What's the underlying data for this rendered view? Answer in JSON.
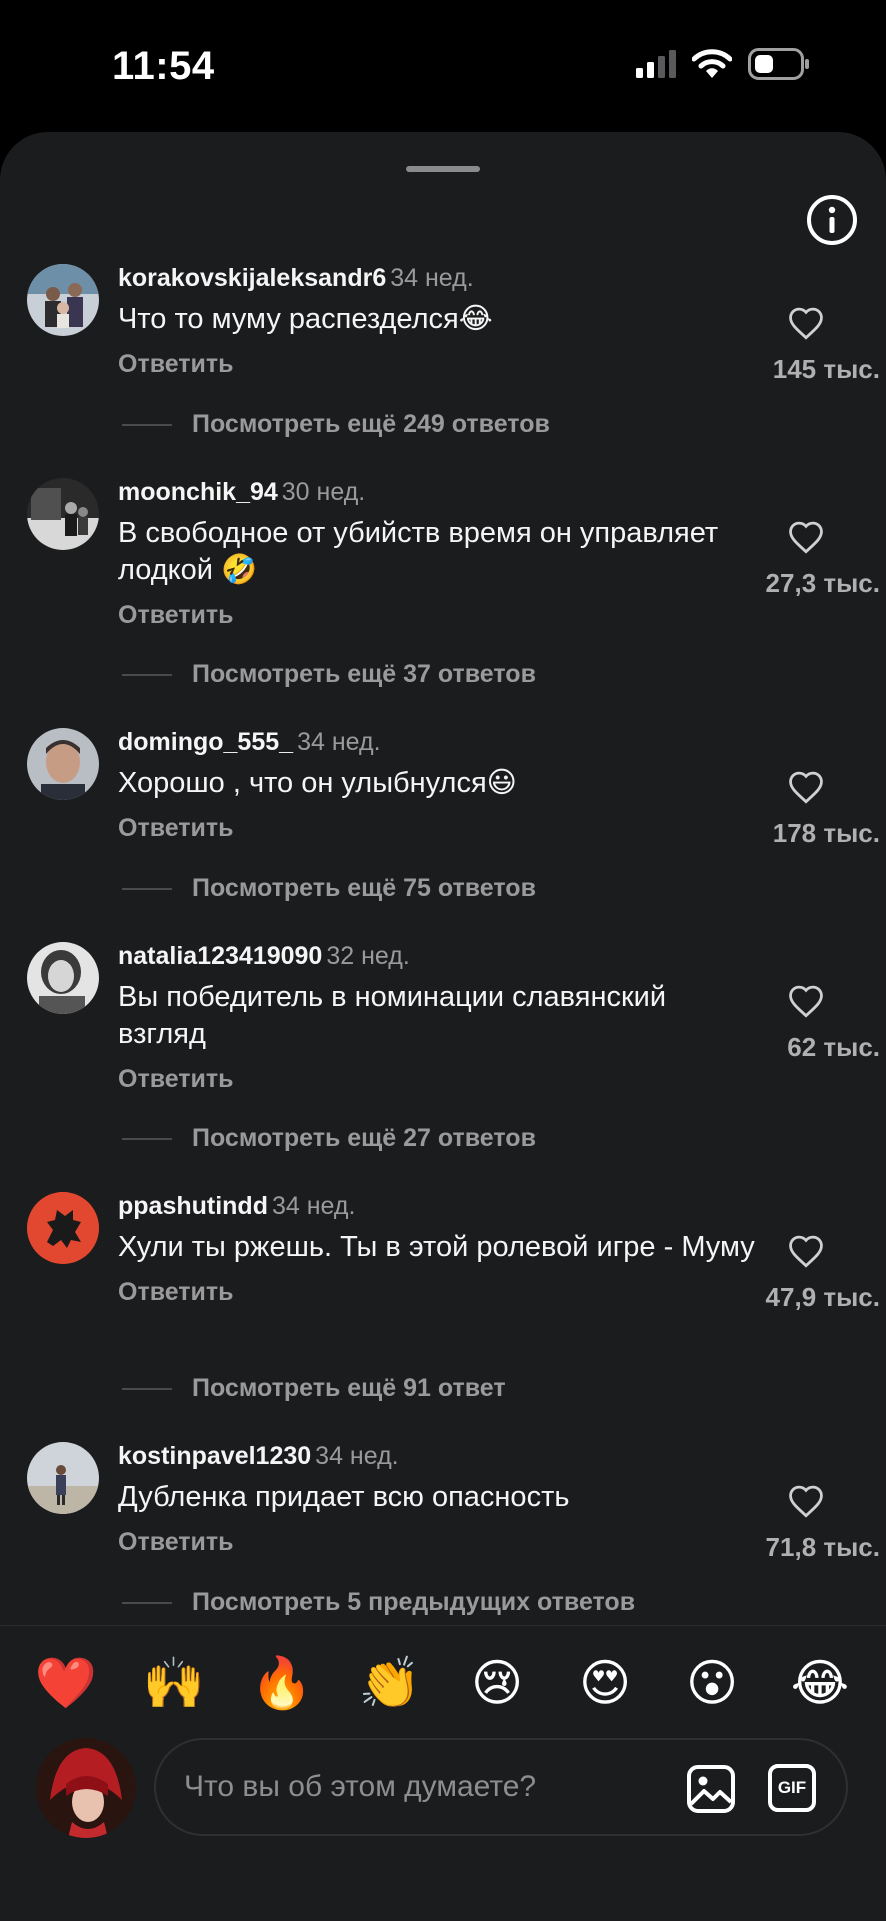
{
  "status": {
    "time": "11:54"
  },
  "comments": [
    {
      "username": "korakovskijaleksandr6",
      "time": "34 нед.",
      "text": "Что то муму распезделся😂",
      "reply": "Ответить",
      "likes": "145 тыс.",
      "more": "Посмотреть ещё 249 ответов"
    },
    {
      "username": "moonchik_94",
      "time": "30 нед.",
      "text": "В свободное от убийств время он управляет лодкой 🤣",
      "reply": "Ответить",
      "likes": "27,3 тыс.",
      "more": "Посмотреть ещё 37 ответов"
    },
    {
      "username": "domingo_555_",
      "time": "34 нед.",
      "text": "Хорошо , что он улыбнулся😃",
      "reply": "Ответить",
      "likes": "178 тыс.",
      "more": "Посмотреть ещё 75 ответов"
    },
    {
      "username": "natalia123419090",
      "time": "32 нед.",
      "text": "Вы победитель в номинации славянский взгляд",
      "reply": "Ответить",
      "likes": "62 тыс.",
      "more": "Посмотреть ещё 27 ответов"
    },
    {
      "username": "ppashutindd",
      "time": "34 нед.",
      "text": "Хули ты ржешь. Ты в этой ролевой игре - Муму",
      "reply": "Ответить",
      "likes": "47,9 тыс.",
      "more": "Посмотреть ещё 91 ответ"
    },
    {
      "username": "kostinpavel1230",
      "time": "34 нед.",
      "text": "Дубленка придает всю опасность",
      "reply": "Ответить",
      "likes": "71,8 тыс.",
      "more": "Посмотреть 5 предыдущих ответов"
    }
  ],
  "reactions": [
    "❤️",
    "🙌",
    "🔥",
    "👏",
    "😢",
    "😍",
    "😮",
    "😂"
  ],
  "composer": {
    "placeholder": "Что вы об этом думаете?",
    "gif_label": "GIF"
  },
  "colors": {
    "background": "#000000",
    "sheet": "#1b1c1e",
    "muted_text": "#9a9a9c",
    "ppashutindd_avatar": "#e2472f"
  }
}
